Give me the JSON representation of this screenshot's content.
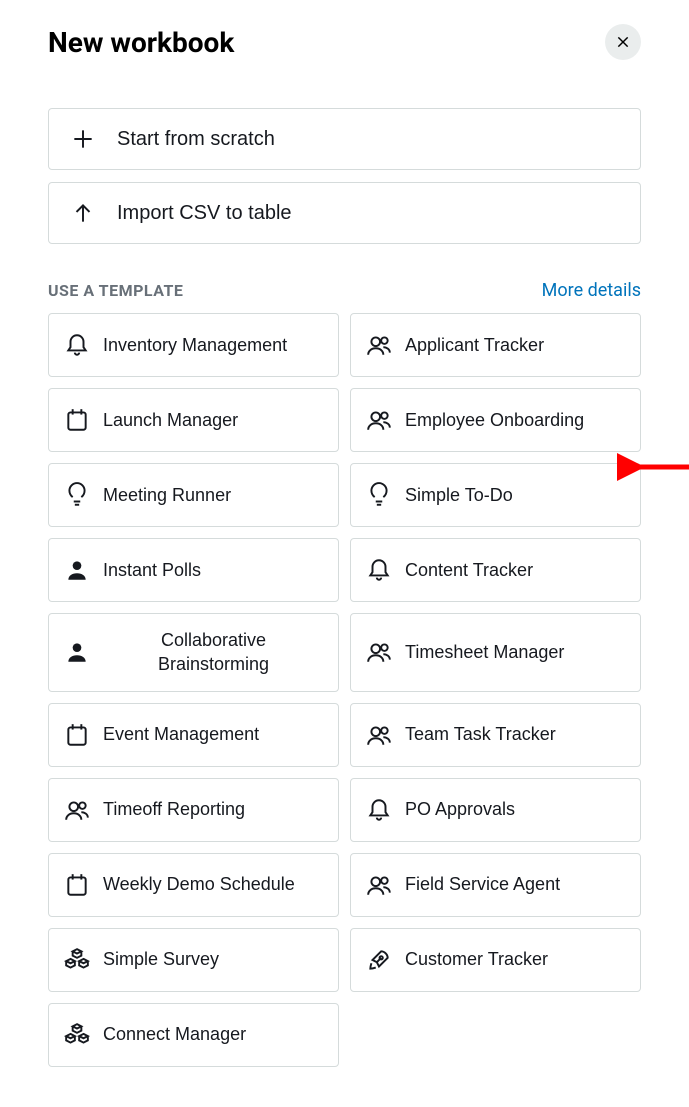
{
  "title": "New workbook",
  "actions": {
    "start_scratch": "Start from scratch",
    "import_csv": "Import CSV to table"
  },
  "section": {
    "label": "USE A TEMPLATE",
    "more": "More details"
  },
  "templates": {
    "left": [
      {
        "label": "Inventory Management",
        "icon": "bell"
      },
      {
        "label": "Launch Manager",
        "icon": "calendar"
      },
      {
        "label": "Meeting Runner",
        "icon": "bulb"
      },
      {
        "label": "Instant Polls",
        "icon": "person"
      },
      {
        "label": "Collaborative Brainstorming",
        "icon": "person"
      },
      {
        "label": "Event Management",
        "icon": "calendar"
      },
      {
        "label": "Timeoff Reporting",
        "icon": "people"
      },
      {
        "label": "Weekly Demo Schedule",
        "icon": "calendar"
      },
      {
        "label": "Simple Survey",
        "icon": "cubes"
      },
      {
        "label": "Connect Manager",
        "icon": "cubes"
      }
    ],
    "right": [
      {
        "label": "Applicant Tracker",
        "icon": "people"
      },
      {
        "label": "Employee Onboarding",
        "icon": "people"
      },
      {
        "label": "Simple To-Do",
        "icon": "bulb"
      },
      {
        "label": "Content Tracker",
        "icon": "bell"
      },
      {
        "label": "Timesheet Manager",
        "icon": "people"
      },
      {
        "label": "Team Task Tracker",
        "icon": "people"
      },
      {
        "label": "PO Approvals",
        "icon": "bell"
      },
      {
        "label": "Field Service Agent",
        "icon": "people"
      },
      {
        "label": "Customer Tracker",
        "icon": "rocket"
      }
    ]
  }
}
